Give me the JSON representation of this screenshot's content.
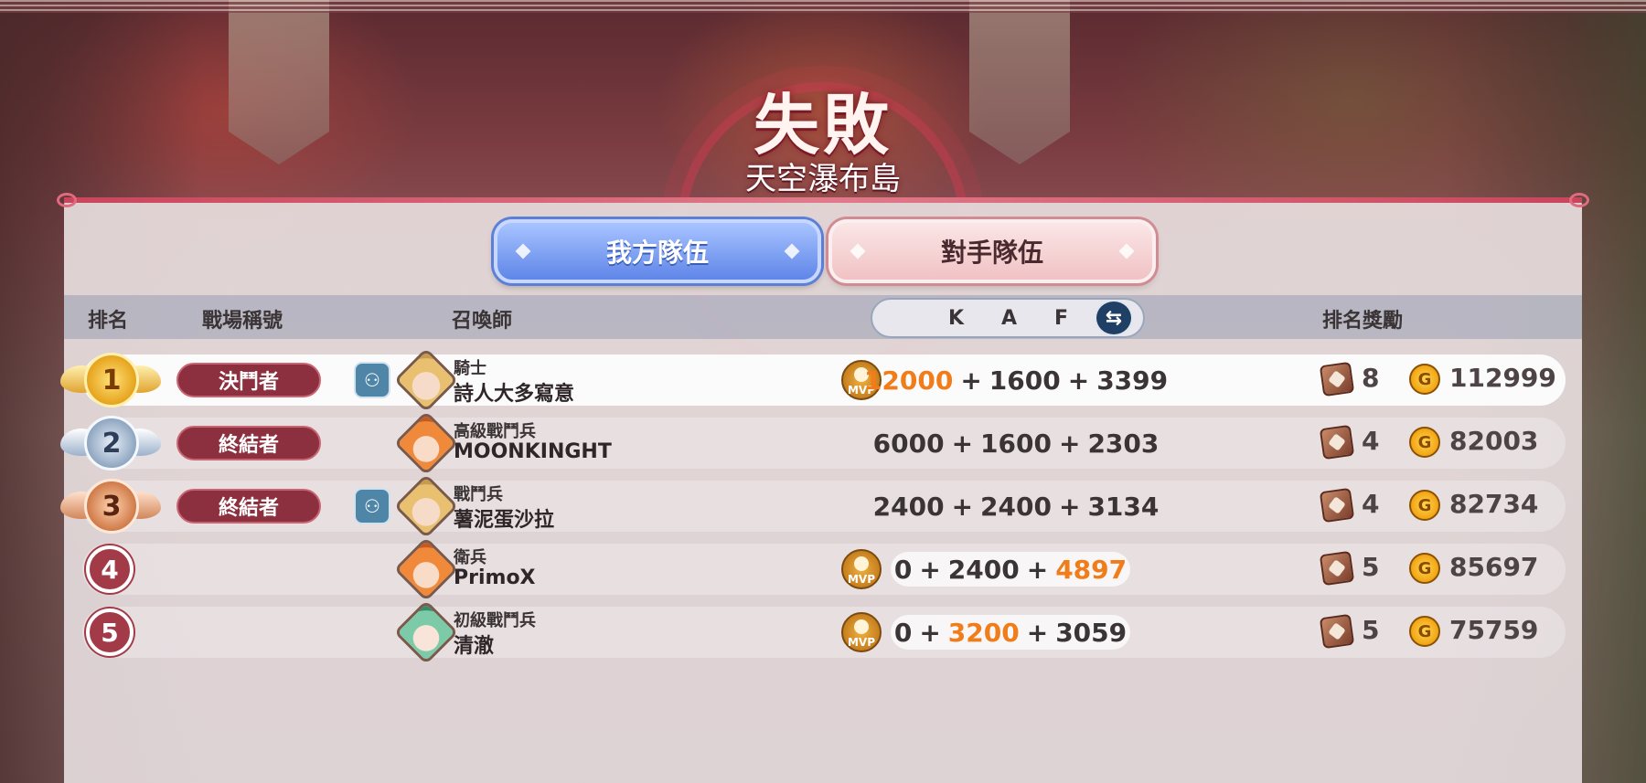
{
  "header": {
    "result": "失敗",
    "map_name": "天空瀑布島"
  },
  "tabs": {
    "own_team": "我方隊伍",
    "enemy_team": "對手隊伍",
    "selected": "own_team"
  },
  "columns": {
    "rank": "排名",
    "battle_title": "戰場稱號",
    "summoner": "召喚師",
    "k": "K",
    "a": "A",
    "f": "F",
    "reward": "排名獎勵"
  },
  "colors": {
    "accent": "#c9455b",
    "highlight": "#f07c1a",
    "own_tab": "#5f86e8",
    "enemy_tab": "#f1c2c4"
  },
  "rows": [
    {
      "rank": "1",
      "title": "決鬥者",
      "class": "騎士",
      "name": "詩人大多寫意",
      "mvp": "MVP",
      "k": "12000",
      "plus1": "+",
      "a": "1600",
      "plus2": "+",
      "f": "3399",
      "chests": "8",
      "gold": "112999"
    },
    {
      "rank": "2",
      "title": "終結者",
      "class": "高級戰鬥兵",
      "name": "MOONKINGHT",
      "k": "6000",
      "plus1": "+",
      "a": "1600",
      "plus2": "+",
      "f": "2303",
      "chests": "4",
      "gold": "82003"
    },
    {
      "rank": "3",
      "title": "終結者",
      "class": "戰鬥兵",
      "name": "薯泥蛋沙拉",
      "k": "2400",
      "plus1": "+",
      "a": "2400",
      "plus2": "+",
      "f": "3134",
      "chests": "4",
      "gold": "82734"
    },
    {
      "rank": "4",
      "class": "衛兵",
      "name": "PrimoX",
      "mvp": "MVP",
      "k": "0",
      "plus1": "+",
      "a": "2400",
      "plus2": "+",
      "f": "4897",
      "chests": "5",
      "gold": "85697"
    },
    {
      "rank": "5",
      "class": "初級戰鬥兵",
      "name": "清澈",
      "mvp": "MVP",
      "k": "0",
      "plus1": "+",
      "a": "3200",
      "plus2": "+",
      "f": "3059",
      "chests": "5",
      "gold": "75759"
    }
  ],
  "icons": {
    "party": "party-icon",
    "swap": "swap-arrows-icon",
    "chest": "chest-icon",
    "coin": "gold-coin-icon",
    "coin_glyph": "G",
    "swap_glyph": "⇆",
    "party_glyph": "⚇"
  }
}
